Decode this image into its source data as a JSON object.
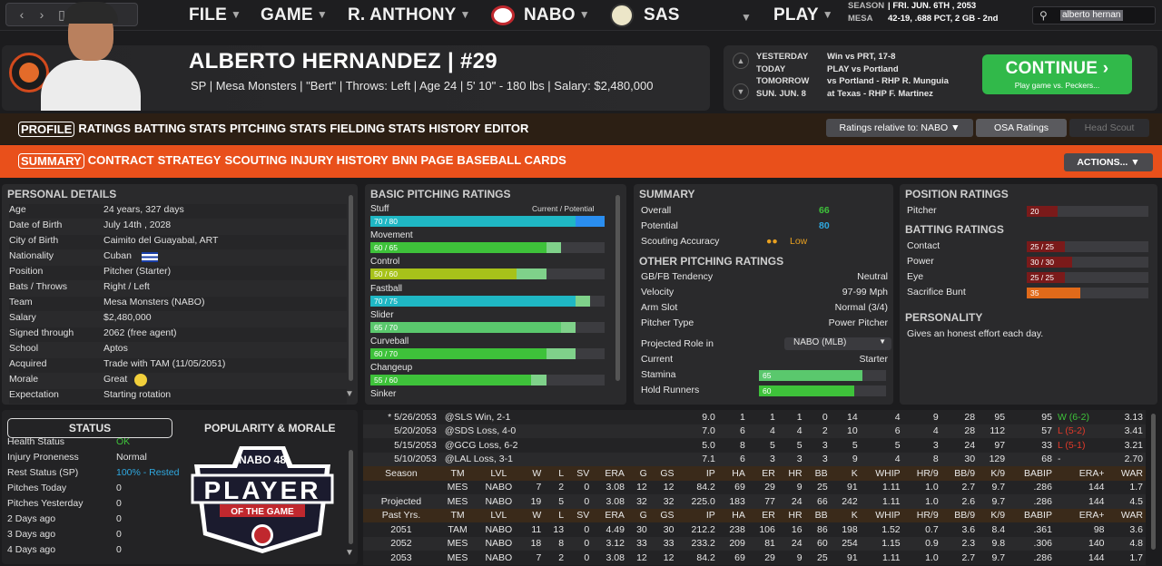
{
  "topbar": {
    "menus": [
      "FILE",
      "GAME",
      "R. ANTHONY",
      "NABO",
      "SAS",
      "PLAY"
    ],
    "season_label": "SEASON",
    "season_value": "FRI. JUN. 6TH , 2053",
    "team_label": "MESA",
    "team_value": "42-19, .688 PCT, 2 GB - 2nd",
    "search_value": "alberto hernan"
  },
  "player": {
    "name": "ALBERTO HERNANDEZ  |  #29",
    "info": "SP | Mesa Monsters  |  \"Bert\"  |  Throws: Left  |  Age 24  |  5' 10\" - 180 lbs  |  Salary: $2,480,000"
  },
  "schedule": [
    {
      "d": "YESTERDAY",
      "v": "Win vs PRT, 17-8"
    },
    {
      "d": "TODAY",
      "v": "PLAY vs Portland"
    },
    {
      "d": "TOMORROW",
      "v": "vs Portland - RHP R. Munguia"
    },
    {
      "d": "SUN. JUN. 8",
      "v": "at Texas - RHP F. Martinez"
    }
  ],
  "continue": {
    "title": "CONTINUE",
    "sub": "Play game vs. Peckers..."
  },
  "tabs1": [
    "PROFILE",
    "RATINGS",
    "BATTING STATS",
    "PITCHING STATS",
    "FIELDING STATS",
    "HISTORY",
    "EDITOR"
  ],
  "tabs2": [
    "SUMMARY",
    "CONTRACT",
    "STRATEGY",
    "SCOUTING",
    "INJURY HISTORY",
    "BNN PAGE",
    "BASEBALL CARDS"
  ],
  "controls": {
    "relative": "Ratings relative to: NABO",
    "osa": "OSA Ratings",
    "scout": "Head Scout",
    "actions": "ACTIONS..."
  },
  "personal": {
    "title": "PERSONAL DETAILS",
    "rows": [
      [
        "Age",
        "24 years, 327 days"
      ],
      [
        "Date of Birth",
        "July 14th , 2028"
      ],
      [
        "City of Birth",
        "Caimito del Guayabal, ART"
      ],
      [
        "Nationality",
        "Cuban"
      ],
      [
        "Position",
        "Pitcher (Starter)"
      ],
      [
        "Bats / Throws",
        "Right / Left"
      ],
      [
        "Team",
        "Mesa Monsters (NABO)"
      ],
      [
        "Salary",
        "$2,480,000"
      ],
      [
        "Signed through",
        "2062 (free agent)"
      ],
      [
        "School",
        "Aptos"
      ],
      [
        "Acquired",
        "Trade with TAM (11/05/2051)"
      ],
      [
        "Morale",
        "Great"
      ],
      [
        "Expectation",
        "Starting rotation"
      ]
    ]
  },
  "pitching": {
    "title": "BASIC PITCHING RATINGS",
    "cp": "Current / Potential",
    "rows": [
      {
        "n": "Stuff",
        "c": 70,
        "p": 80,
        "t": "70 / 80",
        "col": "#1fb7c4"
      },
      {
        "n": "Movement",
        "c": 60,
        "p": 65,
        "t": "60 / 65",
        "col": "#3ec23a"
      },
      {
        "n": "Control",
        "c": 50,
        "p": 60,
        "t": "50 / 60",
        "col": "#a7c21a"
      },
      {
        "n": "Fastball",
        "c": 70,
        "p": 75,
        "t": "70 / 75",
        "col": "#1fb7c4"
      },
      {
        "n": "Slider",
        "c": 65,
        "p": 70,
        "t": "65 / 70",
        "col": "#5ac86d"
      },
      {
        "n": "Curveball",
        "c": 60,
        "p": 70,
        "t": "60 / 70",
        "col": "#3ec23a"
      },
      {
        "n": "Changeup",
        "c": 55,
        "p": 60,
        "t": "55 / 60",
        "col": "#3ec23a"
      },
      {
        "n": "Sinker",
        "c": 0,
        "p": 0,
        "t": "",
        "col": "#3ec23a"
      }
    ]
  },
  "summary": {
    "title": "SUMMARY",
    "overall_l": "Overall",
    "overall": "66",
    "potential_l": "Potential",
    "potential": "80",
    "scout_l": "Scouting Accuracy",
    "scout": "Low",
    "other_title": "OTHER PITCHING RATINGS",
    "other": [
      [
        "GB/FB Tendency",
        "Neutral"
      ],
      [
        "Velocity",
        "97-99 Mph"
      ],
      [
        "Arm Slot",
        "Normal (3/4)"
      ],
      [
        "Pitcher Type",
        "Power Pitcher"
      ]
    ],
    "role_l": "Projected Role in",
    "role": "NABO (MLB)",
    "current_l": "Current",
    "current": "Starter",
    "stamina_l": "Stamina",
    "stamina": 65,
    "hold_l": "Hold Runners",
    "hold": 60
  },
  "position": {
    "title": "POSITION RATINGS",
    "pitcher_l": "Pitcher",
    "pitcher": 20,
    "bat_title": "BATTING RATINGS",
    "bat": [
      [
        "Contact",
        "25 / 25",
        25
      ],
      [
        "Power",
        "30 / 30",
        30
      ],
      [
        "Eye",
        "25 / 25",
        25
      ],
      [
        "Sacrifice Bunt",
        "35",
        35
      ]
    ],
    "pers_title": "PERSONALITY",
    "pers": "Gives an honest effort each day."
  },
  "status": {
    "tab": "STATUS",
    "tab2": "POPULARITY & MORALE",
    "rows": [
      [
        "Health Status",
        "OK"
      ],
      [
        "Injury Proneness",
        "Normal"
      ],
      [
        "Rest Status (SP)",
        "100% - Rested"
      ],
      [
        "Pitches Today",
        "0"
      ],
      [
        "Pitches Yesterday",
        "0"
      ],
      [
        "2 Days ago",
        "0"
      ],
      [
        "3 Days ago",
        "0"
      ],
      [
        "4 Days ago",
        "0"
      ]
    ]
  },
  "badge": {
    "top": "NABO 48",
    "main": "PLAYER",
    "sub": "OF THE GAME"
  },
  "stats": {
    "games": [
      [
        "* 5/26/2053",
        "@SLS Win, 2-1",
        "9.0",
        "1",
        "1",
        "1",
        "0",
        "14",
        "4",
        "9",
        "28",
        "95",
        "95",
        "W (6-2)",
        "3.13"
      ],
      [
        "5/20/2053",
        "@SDS Loss, 4-0",
        "7.0",
        "6",
        "4",
        "4",
        "2",
        "10",
        "6",
        "4",
        "28",
        "112",
        "57",
        "L (5-2)",
        "3.41"
      ],
      [
        "5/15/2053",
        "@GCG Loss, 6-2",
        "5.0",
        "8",
        "5",
        "5",
        "3",
        "5",
        "5",
        "3",
        "24",
        "97",
        "33",
        "L (5-1)",
        "3.21"
      ],
      [
        "5/10/2053",
        "@LAL Loss, 3-1",
        "7.1",
        "6",
        "3",
        "3",
        "3",
        "9",
        "4",
        "8",
        "30",
        "129",
        "68",
        "-",
        "2.70"
      ]
    ],
    "head": [
      "Season",
      "TM",
      "LVL",
      "W",
      "L",
      "SV",
      "ERA",
      "G",
      "GS",
      "IP",
      "HA",
      "ER",
      "HR",
      "BB",
      "K",
      "WHIP",
      "HR/9",
      "BB/9",
      "K/9",
      "BABIP",
      "ERA+",
      "WAR"
    ],
    "season": [
      [
        "",
        "MES",
        "NABO",
        "7",
        "2",
        "0",
        "3.08",
        "12",
        "12",
        "84.2",
        "69",
        "29",
        "9",
        "25",
        "91",
        "1.11",
        "1.0",
        "2.7",
        "9.7",
        ".286",
        "144",
        "1.7"
      ],
      [
        "Projected",
        "MES",
        "NABO",
        "19",
        "5",
        "0",
        "3.08",
        "32",
        "32",
        "225.0",
        "183",
        "77",
        "24",
        "66",
        "242",
        "1.11",
        "1.0",
        "2.6",
        "9.7",
        ".286",
        "144",
        "4.5"
      ]
    ],
    "head2": [
      "Past Yrs.",
      "TM",
      "LVL",
      "W",
      "L",
      "SV",
      "ERA",
      "G",
      "GS",
      "IP",
      "HA",
      "ER",
      "HR",
      "BB",
      "K",
      "WHIP",
      "HR/9",
      "BB/9",
      "K/9",
      "BABIP",
      "ERA+",
      "WAR"
    ],
    "past": [
      [
        "2051",
        "TAM",
        "NABO",
        "11",
        "13",
        "0",
        "4.49",
        "30",
        "30",
        "212.2",
        "238",
        "106",
        "16",
        "86",
        "198",
        "1.52",
        "0.7",
        "3.6",
        "8.4",
        ".361",
        "98",
        "3.6"
      ],
      [
        "2052",
        "MES",
        "NABO",
        "18",
        "8",
        "0",
        "3.12",
        "33",
        "33",
        "233.2",
        "209",
        "81",
        "24",
        "60",
        "254",
        "1.15",
        "0.9",
        "2.3",
        "9.8",
        ".306",
        "140",
        "4.8"
      ],
      [
        "2053",
        "MES",
        "NABO",
        "7",
        "2",
        "0",
        "3.08",
        "12",
        "12",
        "84.2",
        "69",
        "29",
        "9",
        "25",
        "91",
        "1.11",
        "1.0",
        "2.7",
        "9.7",
        ".286",
        "144",
        "1.7"
      ]
    ]
  },
  "colors": {
    "accent": "#e9501b",
    "green": "#31b94a",
    "cyan": "#1fb7c4"
  }
}
